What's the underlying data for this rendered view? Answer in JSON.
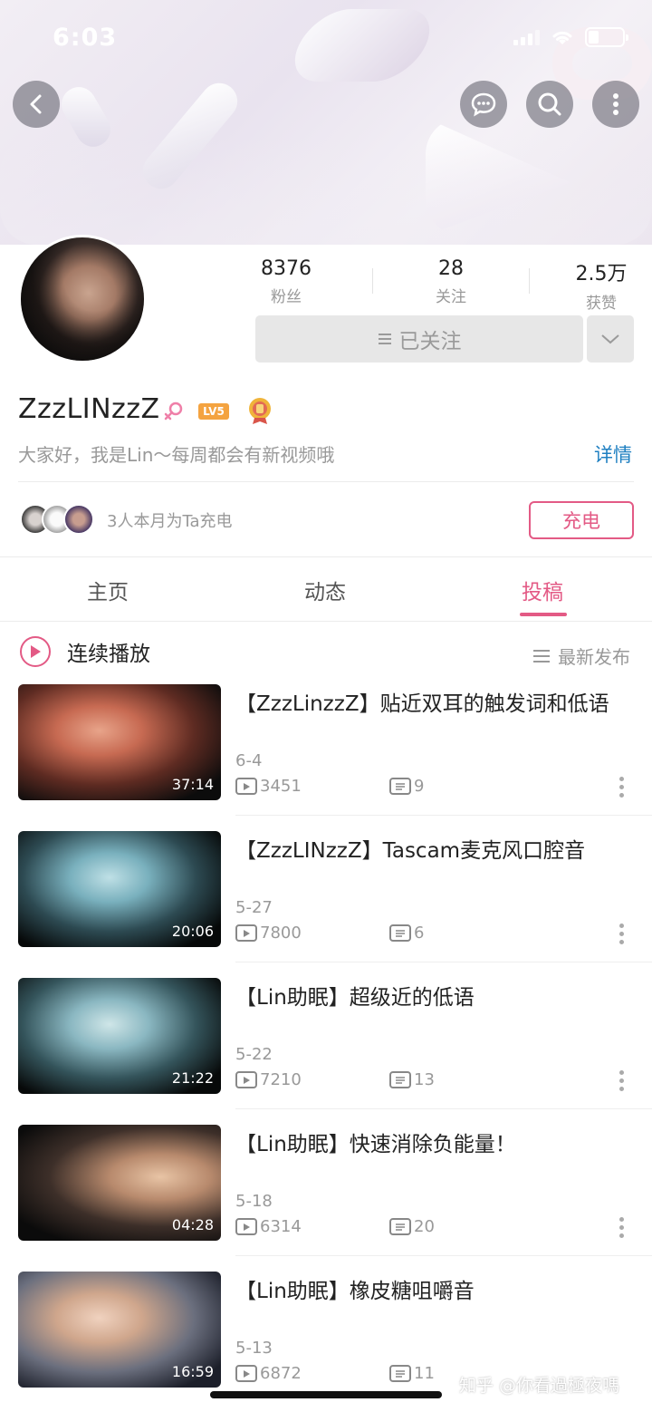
{
  "status_bar": {
    "time": "6:03"
  },
  "header": {
    "icons": [
      "back-icon",
      "message-icon",
      "search-icon",
      "more-icon"
    ]
  },
  "profile": {
    "stats": [
      {
        "value": "8376",
        "label": "粉丝"
      },
      {
        "value": "28",
        "label": "关注"
      },
      {
        "value": "2.5万",
        "label": "获赞"
      }
    ],
    "follow_label": "已关注",
    "username": "ZzzLINzzZ",
    "level": "LV5",
    "bio": "大家好，我是Lin～每周都会有新视频哦",
    "detail_link": "详情",
    "charge_text": "3人本月为Ta充电",
    "charge_button": "充电"
  },
  "tabs": [
    {
      "label": "主页",
      "active": false
    },
    {
      "label": "动态",
      "active": false
    },
    {
      "label": "投稿",
      "active": true
    }
  ],
  "list_header": {
    "play_all": "连续播放",
    "sort": "最新发布"
  },
  "videos": [
    {
      "title": "【ZzzLinzzZ】贴近双耳的触发词和低语",
      "duration": "37:14",
      "date": "6-4",
      "plays": "3451",
      "danmaku": "9"
    },
    {
      "title": "【ZzzLINzzZ】Tascam麦克风口腔音",
      "duration": "20:06",
      "date": "5-27",
      "plays": "7800",
      "danmaku": "6"
    },
    {
      "title": "【Lin助眠】超级近的低语",
      "duration": "21:22",
      "date": "5-22",
      "plays": "7210",
      "danmaku": "13"
    },
    {
      "title": "【Lin助眠】快速消除负能量！",
      "duration": "04:28",
      "date": "5-18",
      "plays": "6314",
      "danmaku": "20"
    },
    {
      "title": "【Lin助眠】橡皮糖咀嚼音",
      "duration": "16:59",
      "date": "5-13",
      "plays": "6872",
      "danmaku": "11"
    }
  ],
  "watermark": "知乎 @你看過極夜嗎",
  "colors": {
    "accent": "#e35a85",
    "link": "#1e7fc1",
    "muted": "#999999"
  }
}
